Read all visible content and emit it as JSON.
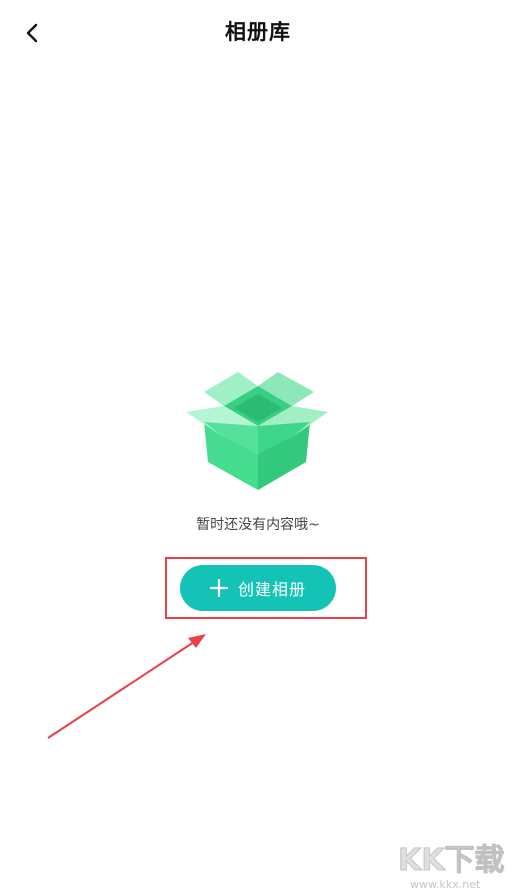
{
  "header": {
    "title": "相册库",
    "back_icon": "chevron-left-icon"
  },
  "empty_state": {
    "message": "暂时还没有内容哦~",
    "illustration": "open-box-icon",
    "illustration_color": "#3ed68b"
  },
  "actions": {
    "create_label": "创建相册",
    "create_icon": "plus-icon",
    "create_color": "#14c2b6"
  },
  "annotation": {
    "highlight_color": "#e8414a"
  },
  "watermark": {
    "brand": "KK下载",
    "url": "www.kkx.net"
  }
}
